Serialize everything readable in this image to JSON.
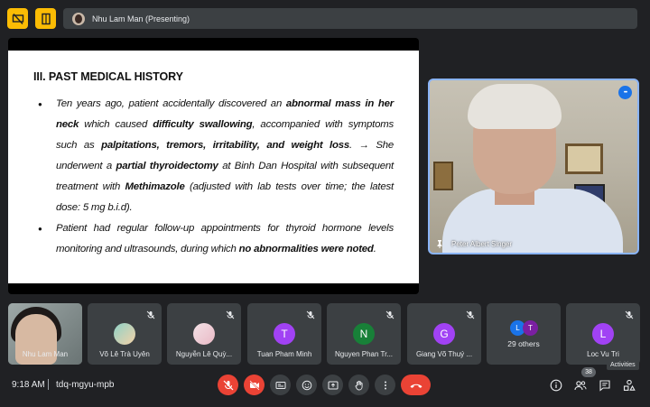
{
  "presenter": {
    "name": "Nhu Lam Man (Presenting)"
  },
  "slide": {
    "title": "III.   PAST MEDICAL HISTORY",
    "bullets": [
      [
        {
          "t": "Ten years ago, patient accidentally discovered an ",
          "b": false
        },
        {
          "t": "abnormal mass in her neck",
          "b": true
        },
        {
          "t": " which caused ",
          "b": false
        },
        {
          "t": "difficulty swallowing",
          "b": true
        },
        {
          "t": ", accompanied with symptoms such as ",
          "b": false
        },
        {
          "t": "palpitations, tremors, irritability, and weight loss",
          "b": true
        },
        {
          "t": ". → She underwent a ",
          "b": false
        },
        {
          "t": "partial thyroidectomy",
          "b": true
        },
        {
          "t": " at Binh Dan Hospital with subsequent treatment with ",
          "b": false
        },
        {
          "t": "Methimazole",
          "b": true
        },
        {
          "t": " (adjusted with lab tests over time; the latest dose: 5 mg b.i.d).",
          "b": false
        }
      ],
      [
        {
          "t": "Patient had regular follow-up appointments for thyroid hormone levels monitoring and ultrasounds, during which ",
          "b": false
        },
        {
          "t": "no abnormalities were noted",
          "b": true
        },
        {
          "t": ".",
          "b": false
        }
      ]
    ]
  },
  "speaker": {
    "name": "Peter Albert Singer",
    "more_glyph": "•••"
  },
  "participants": {
    "self_name": "Nhu Lam Man",
    "p1": "Võ Lê Trà Uyên",
    "p2": "Nguyễn Lê Quỳ...",
    "p3": {
      "name": "Tuan Pham Minh",
      "initial": "T",
      "color": "#a142f4"
    },
    "p4": {
      "name": "Nguyen Phan Tr...",
      "initial": "N",
      "color": "#188038"
    },
    "p5": {
      "name": "Giang Võ Thuý ...",
      "initial": "G",
      "color": "#a142f4"
    },
    "others": {
      "label": "29 others",
      "a": "L",
      "b": "T",
      "a_color": "#1a73e8",
      "b_color": "#7b1fa2"
    },
    "p6": {
      "name": "Loc Vu Tri",
      "initial": "L",
      "color": "#a142f4"
    }
  },
  "bottom": {
    "time": "9:18 AM",
    "meeting_code": "tdq-mgyu-mpb",
    "people_count": "38",
    "tooltip": "Activities"
  }
}
